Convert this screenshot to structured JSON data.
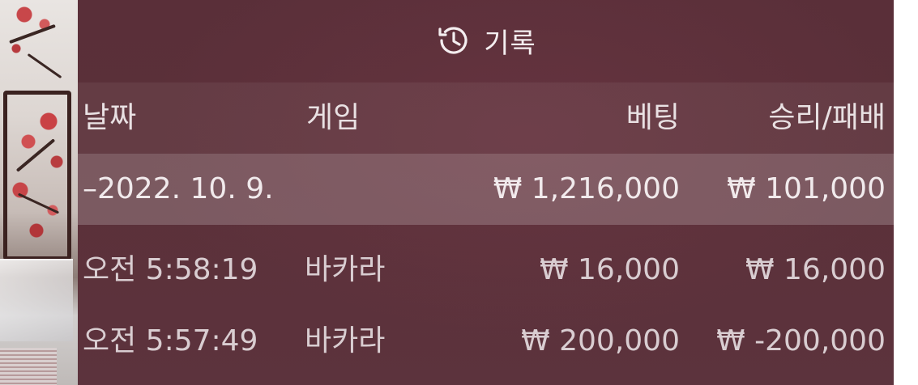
{
  "header": {
    "title": "기록",
    "icon": "history-icon"
  },
  "columns": {
    "date": "날짜",
    "game": "게임",
    "bet": "베팅",
    "result": "승리/패배"
  },
  "date_group": {
    "date": "–2022. 10. 9.",
    "total_bet": "₩ 1,216,000",
    "total_result": "₩ 101,000"
  },
  "rows": [
    {
      "time": "오전 5:58:19",
      "game": "바카라",
      "bet": "₩ 16,000",
      "result": "₩ 16,000"
    },
    {
      "time": "오전 5:57:49",
      "game": "바카라",
      "bet": "₩ 200,000",
      "result": "₩ -200,000"
    }
  ],
  "colors": {
    "panel_bg": "#5b3039",
    "text": "#f1eaec",
    "highlight_row": "rgba(255,255,255,0.20)"
  }
}
